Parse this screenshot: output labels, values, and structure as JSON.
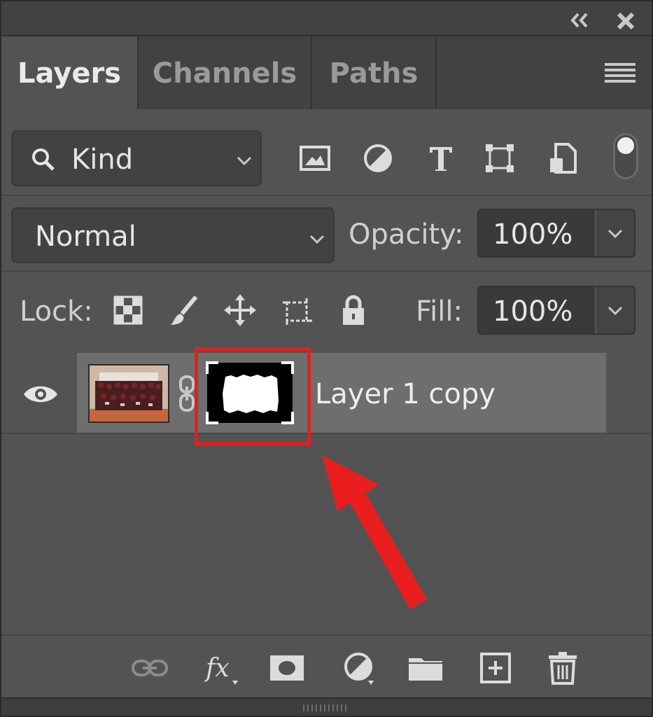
{
  "tabs": [
    {
      "label": "Layers",
      "active": true
    },
    {
      "label": "Channels",
      "active": false
    },
    {
      "label": "Paths",
      "active": false
    }
  ],
  "filter": {
    "kind_label": "Kind"
  },
  "filter_icons": [
    "image-filter-icon",
    "adjustment-filter-icon",
    "type-filter-icon",
    "shape-filter-icon",
    "smart-object-filter-icon"
  ],
  "blend": {
    "mode": "Normal",
    "opacity_label": "Opacity:",
    "opacity_value": "100%"
  },
  "lock": {
    "label": "Lock:",
    "fill_label": "Fill:",
    "fill_value": "100%"
  },
  "layers": [
    {
      "name": "Layer 1 copy",
      "visible": true,
      "has_mask": true,
      "selected": true
    }
  ],
  "footer_icons": [
    "link-layers-icon",
    "fx-icon",
    "add-mask-icon",
    "adjustment-layer-icon",
    "new-group-icon",
    "new-layer-icon",
    "delete-icon"
  ],
  "colors": {
    "panel": "#535353",
    "selected_row": "#6e6e6e",
    "annotation": "#e02020"
  }
}
